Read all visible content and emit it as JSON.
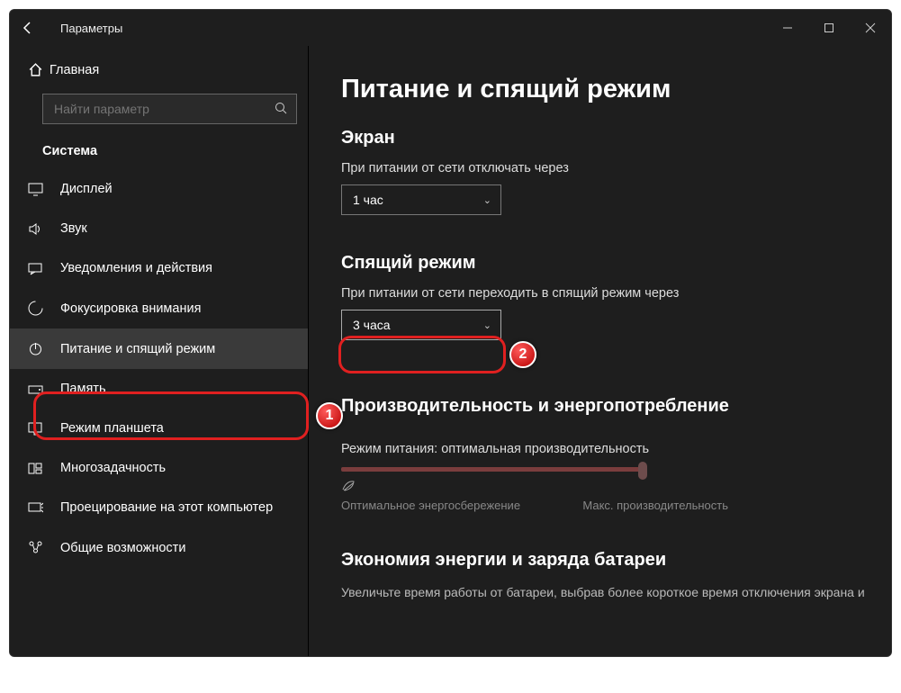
{
  "titlebar": {
    "title": "Параметры"
  },
  "sidebar": {
    "home": "Главная",
    "search_placeholder": "Найти параметр",
    "section": "Система",
    "items": [
      {
        "label": "Дисплей"
      },
      {
        "label": "Звук"
      },
      {
        "label": "Уведомления и действия"
      },
      {
        "label": "Фокусировка внимания"
      },
      {
        "label": "Питание и спящий режим"
      },
      {
        "label": "Память"
      },
      {
        "label": "Режим планшета"
      },
      {
        "label": "Многозадачность"
      },
      {
        "label": "Проецирование на этот компьютер"
      },
      {
        "label": "Общие возможности"
      }
    ]
  },
  "content": {
    "page_title": "Питание и спящий режим",
    "screen": {
      "heading": "Экран",
      "label": "При питании от сети отключать через",
      "value": "1 час"
    },
    "sleep": {
      "heading": "Спящий режим",
      "label": "При питании от сети переходить в спящий режим через",
      "value": "3 часа"
    },
    "perf": {
      "heading": "Производительность и энергопотребление",
      "mode_label": "Режим питания: оптимальная производительность",
      "low": "Оптимальное энергосбережение",
      "high": "Макс. производительность"
    },
    "battery": {
      "heading": "Экономия энергии и заряда батареи",
      "text": "Увеличьте время работы от батареи, выбрав более короткое время отключения экрана и"
    }
  },
  "annotations": {
    "n1": "1",
    "n2": "2"
  }
}
